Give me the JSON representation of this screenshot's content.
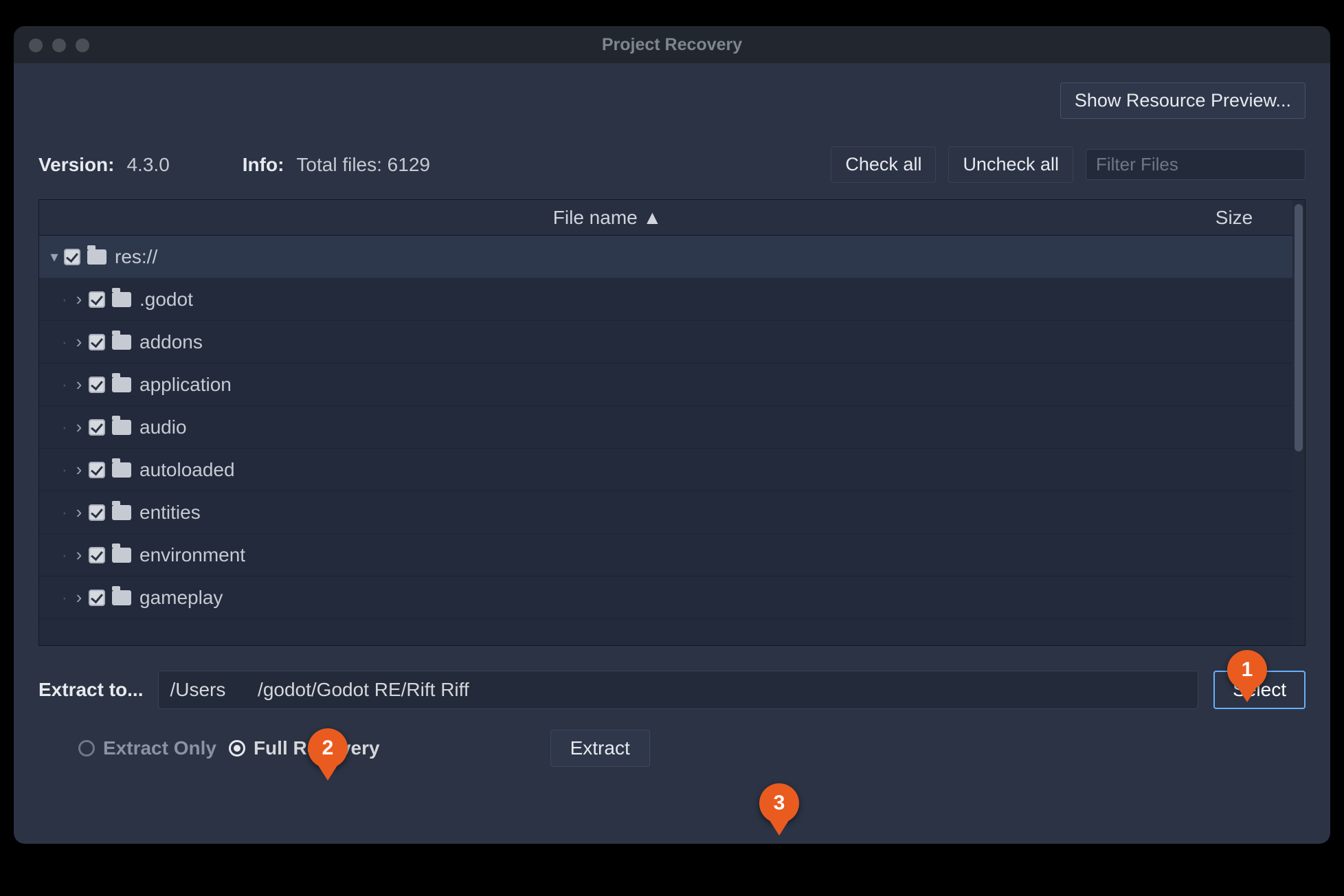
{
  "titlebar": {
    "title": "Project Recovery"
  },
  "preview_button": "Show Resource Preview...",
  "version_label": "Version:",
  "version_value": "4.3.0",
  "info_label": "Info:",
  "info_value": "Total files: 6129",
  "check_all": "Check all",
  "uncheck_all": "Uncheck all",
  "filter_placeholder": "Filter Files",
  "columns": {
    "name": "File name ▲",
    "size": "Size"
  },
  "tree": {
    "root": "res://",
    "children": [
      ".godot",
      "addons",
      "application",
      "audio",
      "autoloaded",
      "entities",
      "environment",
      "gameplay"
    ]
  },
  "extract_to_label": "Extract to...",
  "extract_path_prefix": "/Users",
  "extract_path_suffix": "/godot/Godot RE/Rift Riff",
  "select_label": "Select",
  "radio_extract_only": "Extract Only",
  "radio_full_recovery": "Full Recovery",
  "extract_button": "Extract",
  "markers": {
    "one": "1",
    "two": "2",
    "three": "3"
  }
}
